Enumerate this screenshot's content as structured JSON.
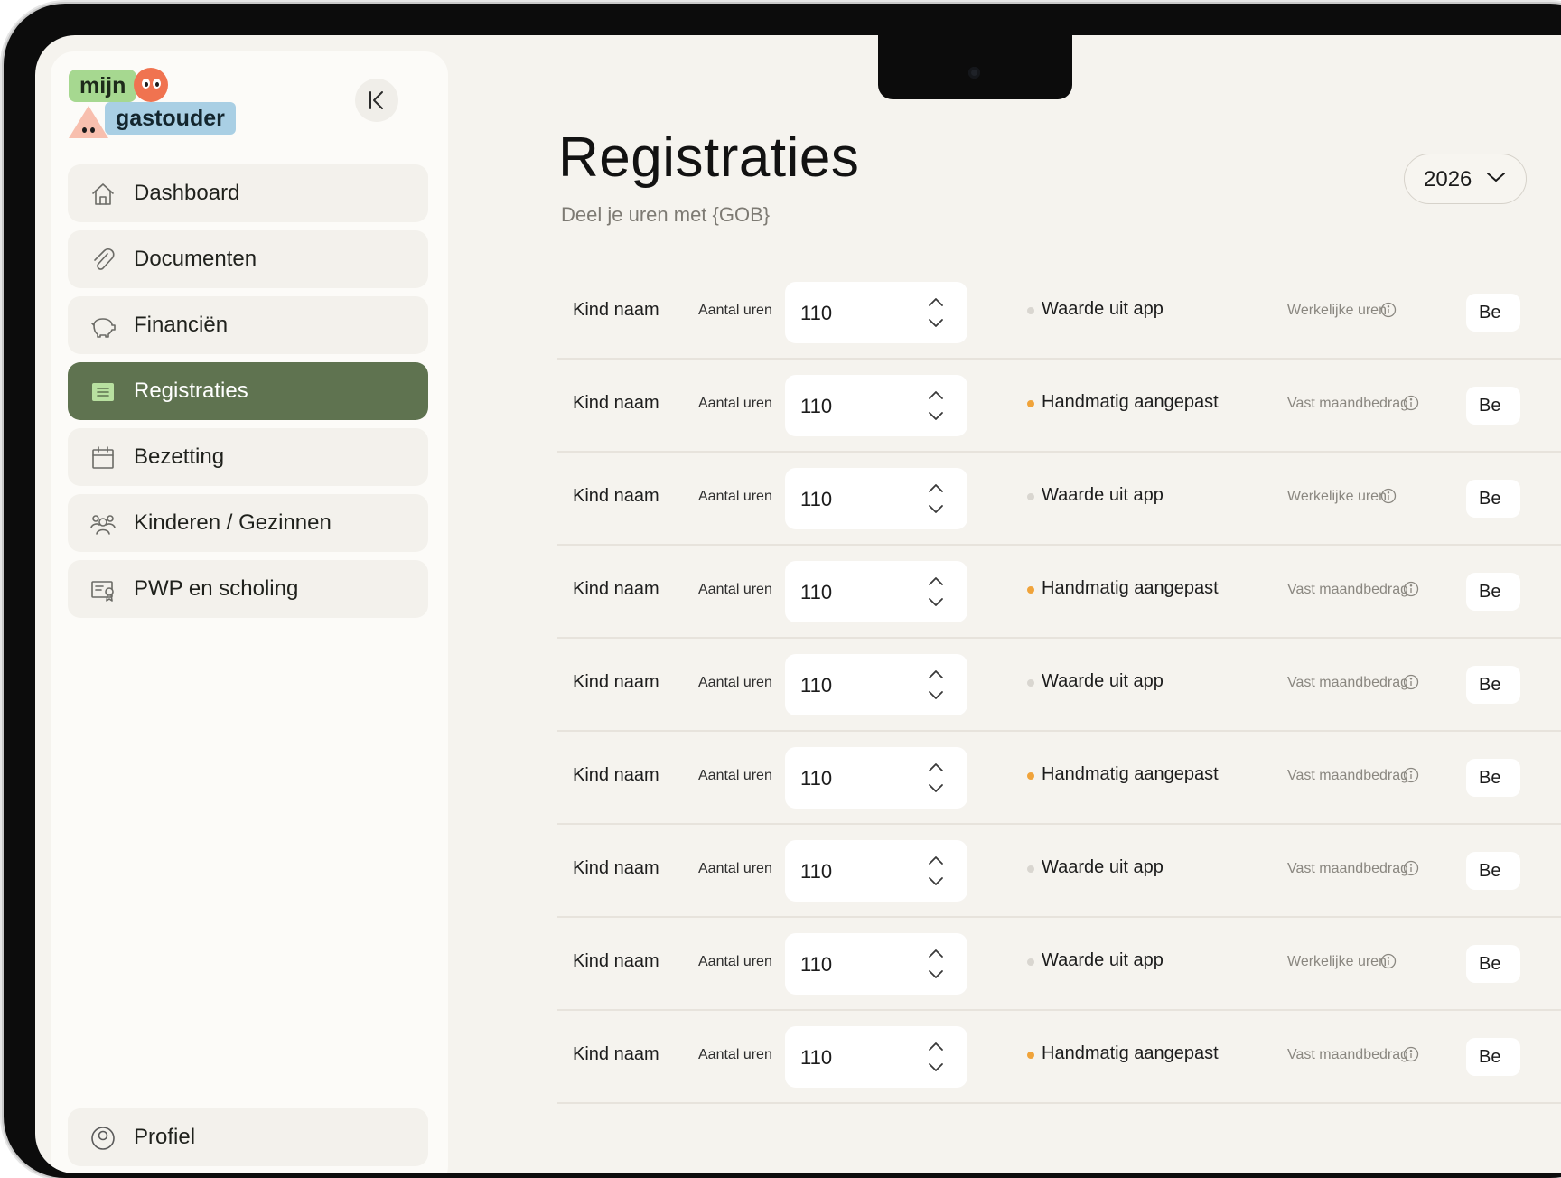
{
  "brand": {
    "line1": "mijn",
    "line2": "gastouder"
  },
  "sidebar": {
    "items": [
      {
        "label": "Dashboard",
        "icon": "home-icon",
        "active": false
      },
      {
        "label": "Documenten",
        "icon": "paperclip-icon",
        "active": false
      },
      {
        "label": "Financiën",
        "icon": "piggy-bank-icon",
        "active": false
      },
      {
        "label": "Registraties",
        "icon": "list-icon",
        "active": true
      },
      {
        "label": "Bezetting",
        "icon": "calendar-icon",
        "active": false
      },
      {
        "label": "Kinderen / Gezinnen",
        "icon": "people-icon",
        "active": false
      },
      {
        "label": "PWP en scholing",
        "icon": "certificate-icon",
        "active": false
      }
    ],
    "profile_label": "Profiel"
  },
  "page": {
    "title": "Registraties",
    "subtitle": "Deel je uren met {GOB}",
    "year": "2026"
  },
  "colors": {
    "active_nav": "#5f7350",
    "dot_manual": "#f0a33a",
    "dot_app": "#d9d6d0",
    "background": "#f5f3ee"
  },
  "rows": [
    {
      "name": "Kind naam",
      "hours_label": "Aantal uren",
      "hours": "110",
      "status": "Waarde uit app",
      "status_kind": "app",
      "type": "Werkelijke uren",
      "button": "Be"
    },
    {
      "name": "Kind naam",
      "hours_label": "Aantal uren",
      "hours": "110",
      "status": "Handmatig aangepast",
      "status_kind": "manual",
      "type": "Vast maandbedrag",
      "button": "Be"
    },
    {
      "name": "Kind naam",
      "hours_label": "Aantal uren",
      "hours": "110",
      "status": "Waarde uit app",
      "status_kind": "app",
      "type": "Werkelijke uren",
      "button": "Be"
    },
    {
      "name": "Kind naam",
      "hours_label": "Aantal uren",
      "hours": "110",
      "status": "Handmatig aangepast",
      "status_kind": "manual",
      "type": "Vast maandbedrag",
      "button": "Be"
    },
    {
      "name": "Kind naam",
      "hours_label": "Aantal uren",
      "hours": "110",
      "status": "Waarde uit app",
      "status_kind": "app",
      "type": "Vast maandbedrag",
      "button": "Be"
    },
    {
      "name": "Kind naam",
      "hours_label": "Aantal uren",
      "hours": "110",
      "status": "Handmatig aangepast",
      "status_kind": "manual",
      "type": "Vast maandbedrag",
      "button": "Be"
    },
    {
      "name": "Kind naam",
      "hours_label": "Aantal uren",
      "hours": "110",
      "status": "Waarde uit app",
      "status_kind": "app",
      "type": "Vast maandbedrag",
      "button": "Be"
    },
    {
      "name": "Kind naam",
      "hours_label": "Aantal uren",
      "hours": "110",
      "status": "Waarde uit app",
      "status_kind": "app",
      "type": "Werkelijke uren",
      "button": "Be"
    },
    {
      "name": "Kind naam",
      "hours_label": "Aantal uren",
      "hours": "110",
      "status": "Handmatig aangepast",
      "status_kind": "manual",
      "type": "Vast maandbedrag",
      "button": "Be"
    }
  ]
}
